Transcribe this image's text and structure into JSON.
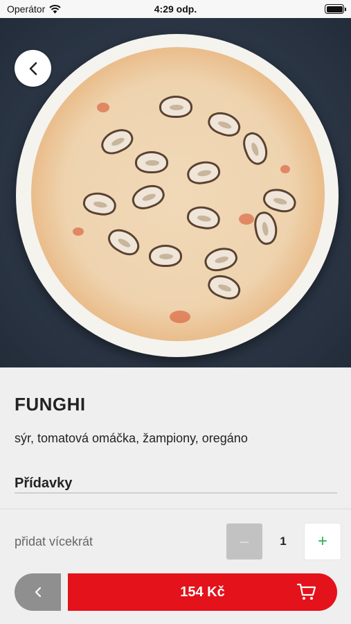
{
  "status_bar": {
    "carrier": "Operátor",
    "time": "4:29 odp."
  },
  "product": {
    "name": "FUNGHI",
    "description": "sýr, tomatová omáčka, žampiony, oregáno",
    "image_icon": "pizza-image"
  },
  "extras": {
    "title": "Přídavky"
  },
  "quantity": {
    "label": "přidat vícekrát",
    "minus": "–",
    "value": "1",
    "plus": "+"
  },
  "cart": {
    "price": "154 Kč"
  },
  "colors": {
    "accent_red": "#e3121b",
    "plus_green": "#2ab34f",
    "back_gray": "#8f8f8f"
  }
}
